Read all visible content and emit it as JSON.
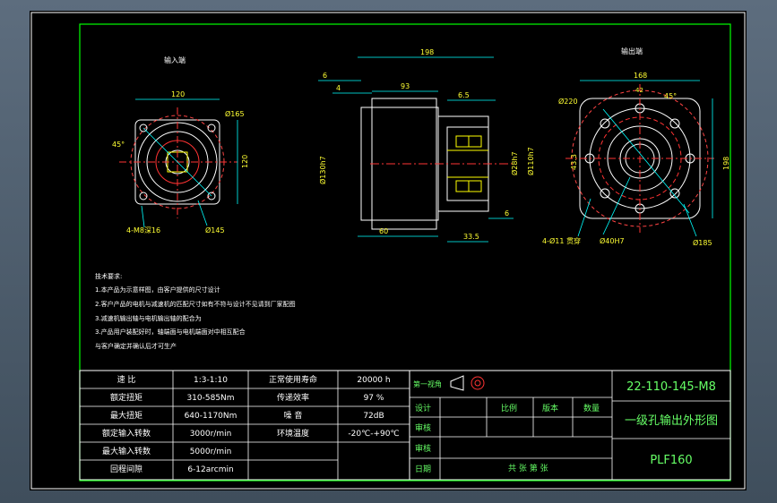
{
  "views": {
    "input_title": "输入端",
    "output_title": "输出端"
  },
  "dims_input": {
    "w120": "120",
    "d165": "Ø165",
    "h120": "120",
    "a45": "45°",
    "thread": "4-M8深16",
    "d145": "Ø145"
  },
  "dims_side": {
    "l198": "198",
    "l6a": "6",
    "l4": "4",
    "l93": "93",
    "l6_5": "6.5",
    "d130": "Ø130h7",
    "d28": "Ø28h7",
    "d110": "Ø110h7",
    "l60": "60",
    "l6b": "6",
    "l33_5": "33.5"
  },
  "dims_output": {
    "w168": "168",
    "w42": "42",
    "a45": "45°",
    "d220": "Ø220",
    "h43_3": "43.3",
    "h198": "198",
    "holes": "4-Ø11 贯穿",
    "d40": "Ø40H7",
    "d185": "Ø185"
  },
  "notes": [
    "技术要求:",
    "1.本产品为示意样图，由客户提供的尺寸设计",
    "2.客户产品的电机与减速机的匹配尺寸如有不符与设计不见请到厂家配图",
    "3.减速机输出轴与电机输出轴的配合为",
    "3.产品用户装配好时，轴端面与电机端面对中相互配合",
    "与客户确定并确认后才可生产"
  ],
  "specs": [
    {
      "label": "速 比",
      "value": "1:3-1:10",
      "label2": "正常使用寿命",
      "value2": "20000 h"
    },
    {
      "label": "额定扭矩",
      "value": "310-585Nm",
      "label2": "传递效率",
      "value2": "97 %"
    },
    {
      "label": "最大扭矩",
      "value": "640-1170Nm",
      "label2": "噪 音",
      "value2": "72dB"
    },
    {
      "label": "额定输入转数",
      "value": "3000r/min",
      "label2": "环境温度",
      "value2": "-20℃-+90℃"
    },
    {
      "label": "最大输入转数",
      "value": "5000r/min",
      "label2": "",
      "value2": ""
    },
    {
      "label": "回程间隙",
      "value": "6-12arcmin",
      "label2": "",
      "value2": ""
    }
  ],
  "titleblock": {
    "first_view": "第一视角",
    "design": "设计",
    "check": "审核",
    "approve": "审核",
    "date": "日期",
    "scale": "比例",
    "version": "版本",
    "qty": "数量",
    "sheets": "共  张  第  张",
    "part_no": "22-110-145-M8",
    "drawing_title": "一级孔输出外形图",
    "model": "PLF160"
  }
}
